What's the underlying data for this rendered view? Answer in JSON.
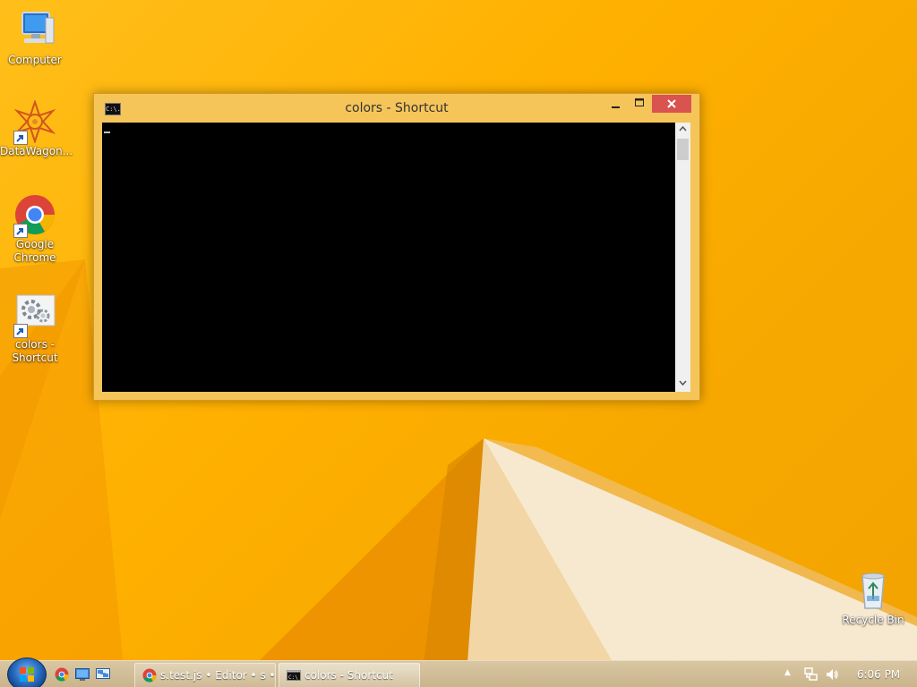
{
  "desktop": {
    "icons": [
      {
        "label": "Computer",
        "icon": "computer-icon"
      },
      {
        "label": "DataWagon...",
        "icon": "datawagon-icon"
      },
      {
        "label": "Google Chrome",
        "icon": "chrome-icon"
      },
      {
        "label": "colors - Shortcut",
        "icon": "shortcut-settings-icon"
      }
    ],
    "recycle_bin": {
      "label": "Recycle Bin",
      "icon": "recycle-bin-icon"
    }
  },
  "console_window": {
    "title": "colors - Shortcut",
    "icon": "console-icon",
    "icon_text": "C:\\.",
    "controls": {
      "minimize": "minimize-icon",
      "maximize": "maximize-icon",
      "close": "close-icon"
    },
    "scrollbar": {
      "up": "chevron-up-icon",
      "down": "chevron-down-icon"
    }
  },
  "taskbar": {
    "start": "windows-start-icon",
    "quick_launch": [
      "chrome-icon",
      "desktop-icon",
      "network-icon"
    ],
    "tasks": [
      {
        "label": "s.test.js • Editor • s • UI-...",
        "icon": "chrome-icon",
        "active": false
      },
      {
        "label": "colors - Shortcut",
        "icon": "console-icon",
        "active": true
      }
    ],
    "tray": {
      "arrow": "▲",
      "network_icon": "network-tray-icon",
      "volume_icon": "volume-icon",
      "clock": "6:06 PM"
    }
  },
  "colors": {
    "wallpaper": "#ffb000",
    "console_frame": "#f6c55a",
    "close_button": "#d9534f",
    "console_background": "#000000"
  }
}
